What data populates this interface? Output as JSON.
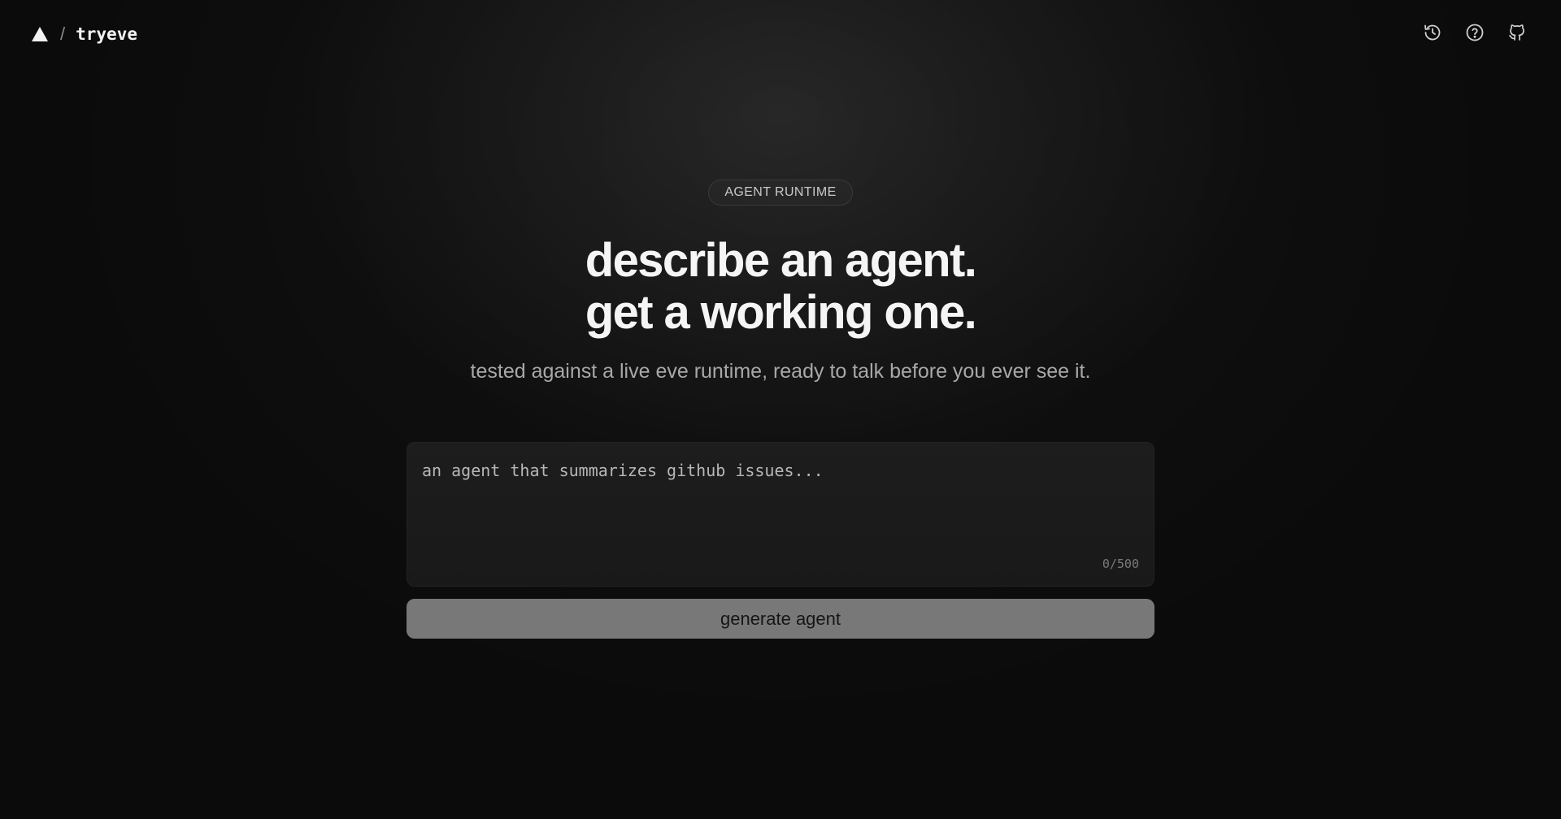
{
  "header": {
    "logo_icon": "triangle-logo-icon",
    "separator": "/",
    "brand_name": "tryeve",
    "actions": [
      {
        "icon": "history-icon"
      },
      {
        "icon": "help-circle-icon"
      },
      {
        "icon": "github-icon"
      }
    ]
  },
  "hero": {
    "badge": "AGENT RUNTIME",
    "headline_line1": "describe an agent.",
    "headline_line2": "get a working one.",
    "subtitle": "tested against a live eve runtime, ready to talk before you ever see it."
  },
  "prompt": {
    "value": "",
    "placeholder": "an agent that summarizes github issues...",
    "char_count": "0/500"
  },
  "actions": {
    "generate_label": "generate agent"
  },
  "colors": {
    "background": "#0b0b0b",
    "button": "#787878",
    "text": "#f5f5f5"
  }
}
